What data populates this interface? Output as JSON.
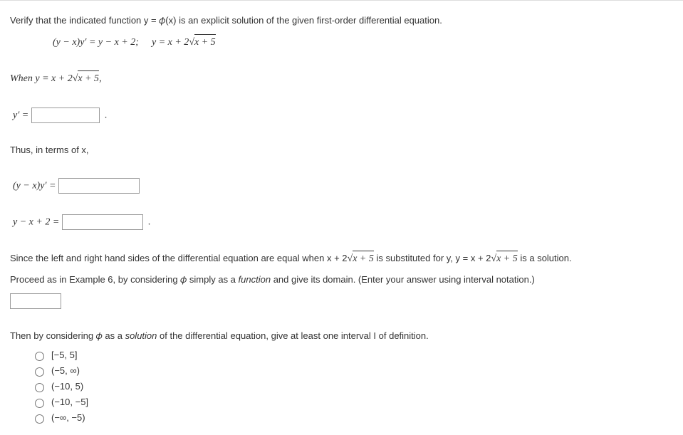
{
  "intro": "Verify that the indicated function y = 𝜙(x) is an explicit solution of the given first-order differential equation.",
  "eq_left": "(y − x)y′ = y − x + 2;",
  "eq_right_pre": "y = x + 2",
  "sqrt_inner": "x + 5",
  "when_pre": "When y = x + 2",
  "when_post": ",",
  "yprime_label": "y′ =",
  "period": ".",
  "thus": "Thus, in terms of x,",
  "lhs1": "(y − x)y′ =",
  "lhs2": "y − x + 2 =",
  "since_pre": "Since the left and right hand sides of the differential equation are equal when x + 2",
  "since_mid": " is substituted for y, y = x + 2",
  "since_post": " is a solution.",
  "proceed": "Proceed as in Example 6, by considering 𝜙 simply as a ",
  "function_word": "function",
  "proceed_post": " and give its domain. (Enter your answer using interval notation.)",
  "then_pre": "Then by considering 𝜙 as a ",
  "solution_word": "solution",
  "then_post": " of the differential equation, give at least one interval I of definition.",
  "options": {
    "o1": "[−5, 5]",
    "o2": "(−5, ∞)",
    "o3": "(−10, 5)",
    "o4": "(−10, −5]",
    "o5": "(−∞, −5)"
  }
}
